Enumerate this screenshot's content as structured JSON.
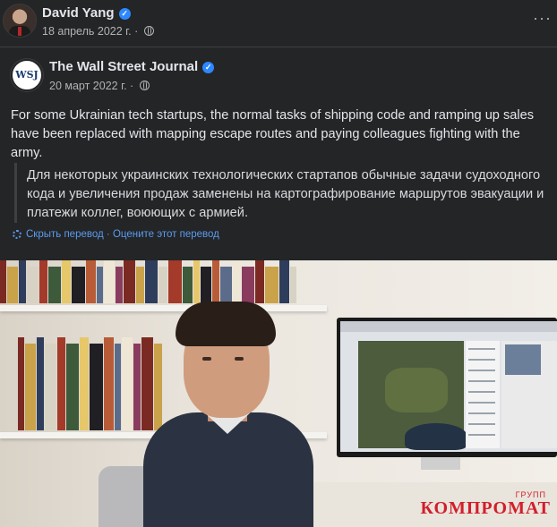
{
  "post": {
    "author": "David Yang",
    "date": "18 апрель 2022 г. ·",
    "more_label": "···"
  },
  "shared": {
    "page_logo": "WSJ",
    "page_name": "The Wall Street Journal",
    "date": "20 март 2022 г. ·",
    "text": "For some Ukrainian tech startups, the normal tasks of shipping code and ramping up sales have been replaced with mapping escape routes and paying colleagues fighting with the army.",
    "translation": "Для некоторых украинских технологических стартапов обычные задачи судоходного кода и увеличения продаж заменены на картографирование маршрутов эвакуации и платежи коллег, воюющих с армией.",
    "hide_translation": "Скрыть перевод",
    "separator": " · ",
    "rate_translation": "Оцените этот перевод"
  },
  "watermark": {
    "main": "КОМПРОМАТ",
    "sub": "ГРУПП"
  },
  "colors": {
    "background": "#242526",
    "text": "#e4e6eb",
    "secondary_text": "#b0b3b8",
    "link": "#5b9bf0",
    "verified": "#2d88ff",
    "watermark": "#d21e2b"
  },
  "icons": [
    "verified-badge-icon",
    "globe-icon",
    "gear-icon",
    "more-options-icon"
  ]
}
